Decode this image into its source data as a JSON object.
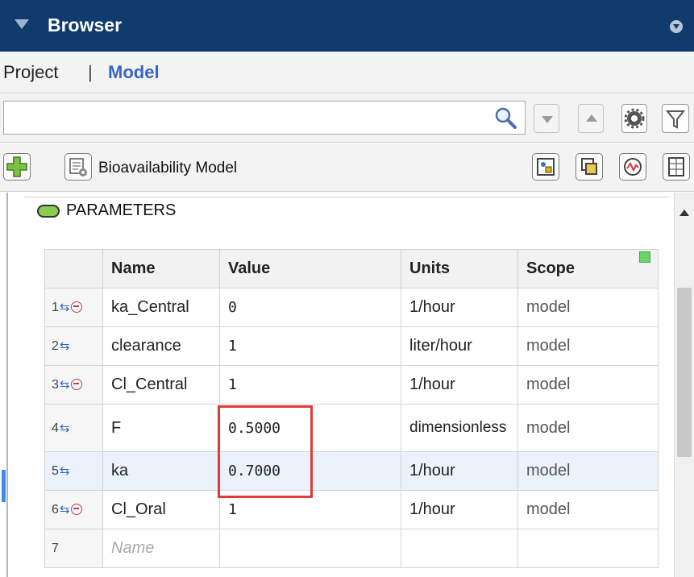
{
  "window": {
    "title": "Browser"
  },
  "breadcrumb": {
    "project": "Project",
    "separator": "|",
    "model": "Model"
  },
  "search": {
    "value": "",
    "placeholder": ""
  },
  "model_toolbar": {
    "model_name": "Bioavailability Model"
  },
  "parameters": {
    "section_label": "PARAMETERS",
    "columns": [
      "Name",
      "Value",
      "Units",
      "Scope"
    ],
    "rows": [
      {
        "index": "1",
        "name": "ka_Central",
        "value": "0",
        "units": "1/hour",
        "scope": "model"
      },
      {
        "index": "2",
        "name": "clearance",
        "value": "1",
        "units": "liter/hour",
        "scope": "model"
      },
      {
        "index": "3",
        "name": "Cl_Central",
        "value": "1",
        "units": "1/hour",
        "scope": "model"
      },
      {
        "index": "4",
        "name": "F",
        "value": "0.5000",
        "units": "dimensionless",
        "scope": "model"
      },
      {
        "index": "5",
        "name": "ka",
        "value": "0.7000",
        "units": "1/hour",
        "scope": "model"
      },
      {
        "index": "6",
        "name": "Cl_Oral",
        "value": "1",
        "units": "1/hour",
        "scope": "model"
      }
    ],
    "new_row": {
      "index": "7",
      "name_placeholder": "Name"
    }
  },
  "colors": {
    "titlebar": "#0f3b6e",
    "link": "#3b63c6",
    "highlight": "#e03a3a",
    "selected_row": "#eaf2fc"
  },
  "icons": [
    "search-icon",
    "next-icon",
    "previous-icon",
    "settings-gear-icon",
    "filter-icon",
    "add-icon",
    "model-properties-icon"
  ]
}
